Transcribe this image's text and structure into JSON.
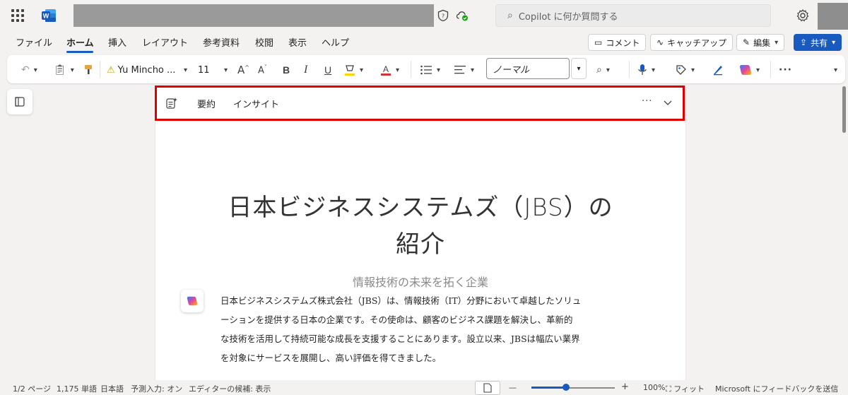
{
  "titlebar": {
    "search_placeholder": "Copilot に何か質問する"
  },
  "menu": {
    "tabs": [
      "ファイル",
      "ホーム",
      "挿入",
      "レイアウト",
      "参考資料",
      "校閲",
      "表示",
      "ヘルプ"
    ],
    "active_tab": "ホーム",
    "comment_label": "コメント",
    "catchup_label": "キャッチアップ",
    "edit_label": "編集",
    "share_label": "共有"
  },
  "ribbon": {
    "font_name": "Yu Mincho ...",
    "font_size": "11",
    "style_name": "ノーマル",
    "more": "···"
  },
  "insights": {
    "summary_label": "要約",
    "insight_label": "インサイト",
    "more": "···"
  },
  "document": {
    "title_line1": "日本ビジネスシステムズ（JBS）の",
    "title_line2": "紹介",
    "subtitle": "情報技術の未来を拓く企業",
    "body_lines": [
      "日本ビジネスシステムズ株式会社（JBS）は、情報技術（IT）分野において卓越したソリュ",
      "ーションを提供する日本の企業です。その使命は、顧客のビジネス課題を解決し、革新的",
      "な技術を活用して持続可能な成長を支援することにあります。設立以来、JBSは幅広い業界",
      "を対象にサービスを展開し、高い評価を得てきました。"
    ]
  },
  "status": {
    "page": "1/2 ページ",
    "words": "1,175 単語",
    "language": "日本語",
    "predictive": "予測入力: オン",
    "editor": "エディターの候補: 表示",
    "zoom_minus": "—",
    "zoom_plus": "+",
    "zoom_level": "100%",
    "zoom_level_value": 100,
    "fit_label": "フィット",
    "feedback": "Microsoft にフィードバックを送信"
  },
  "colors": {
    "accent": "#185abd",
    "highlight_border": "#e00000",
    "copilot_gradient": [
      "#2d7ff9",
      "#e5469a",
      "#ffb900"
    ]
  }
}
